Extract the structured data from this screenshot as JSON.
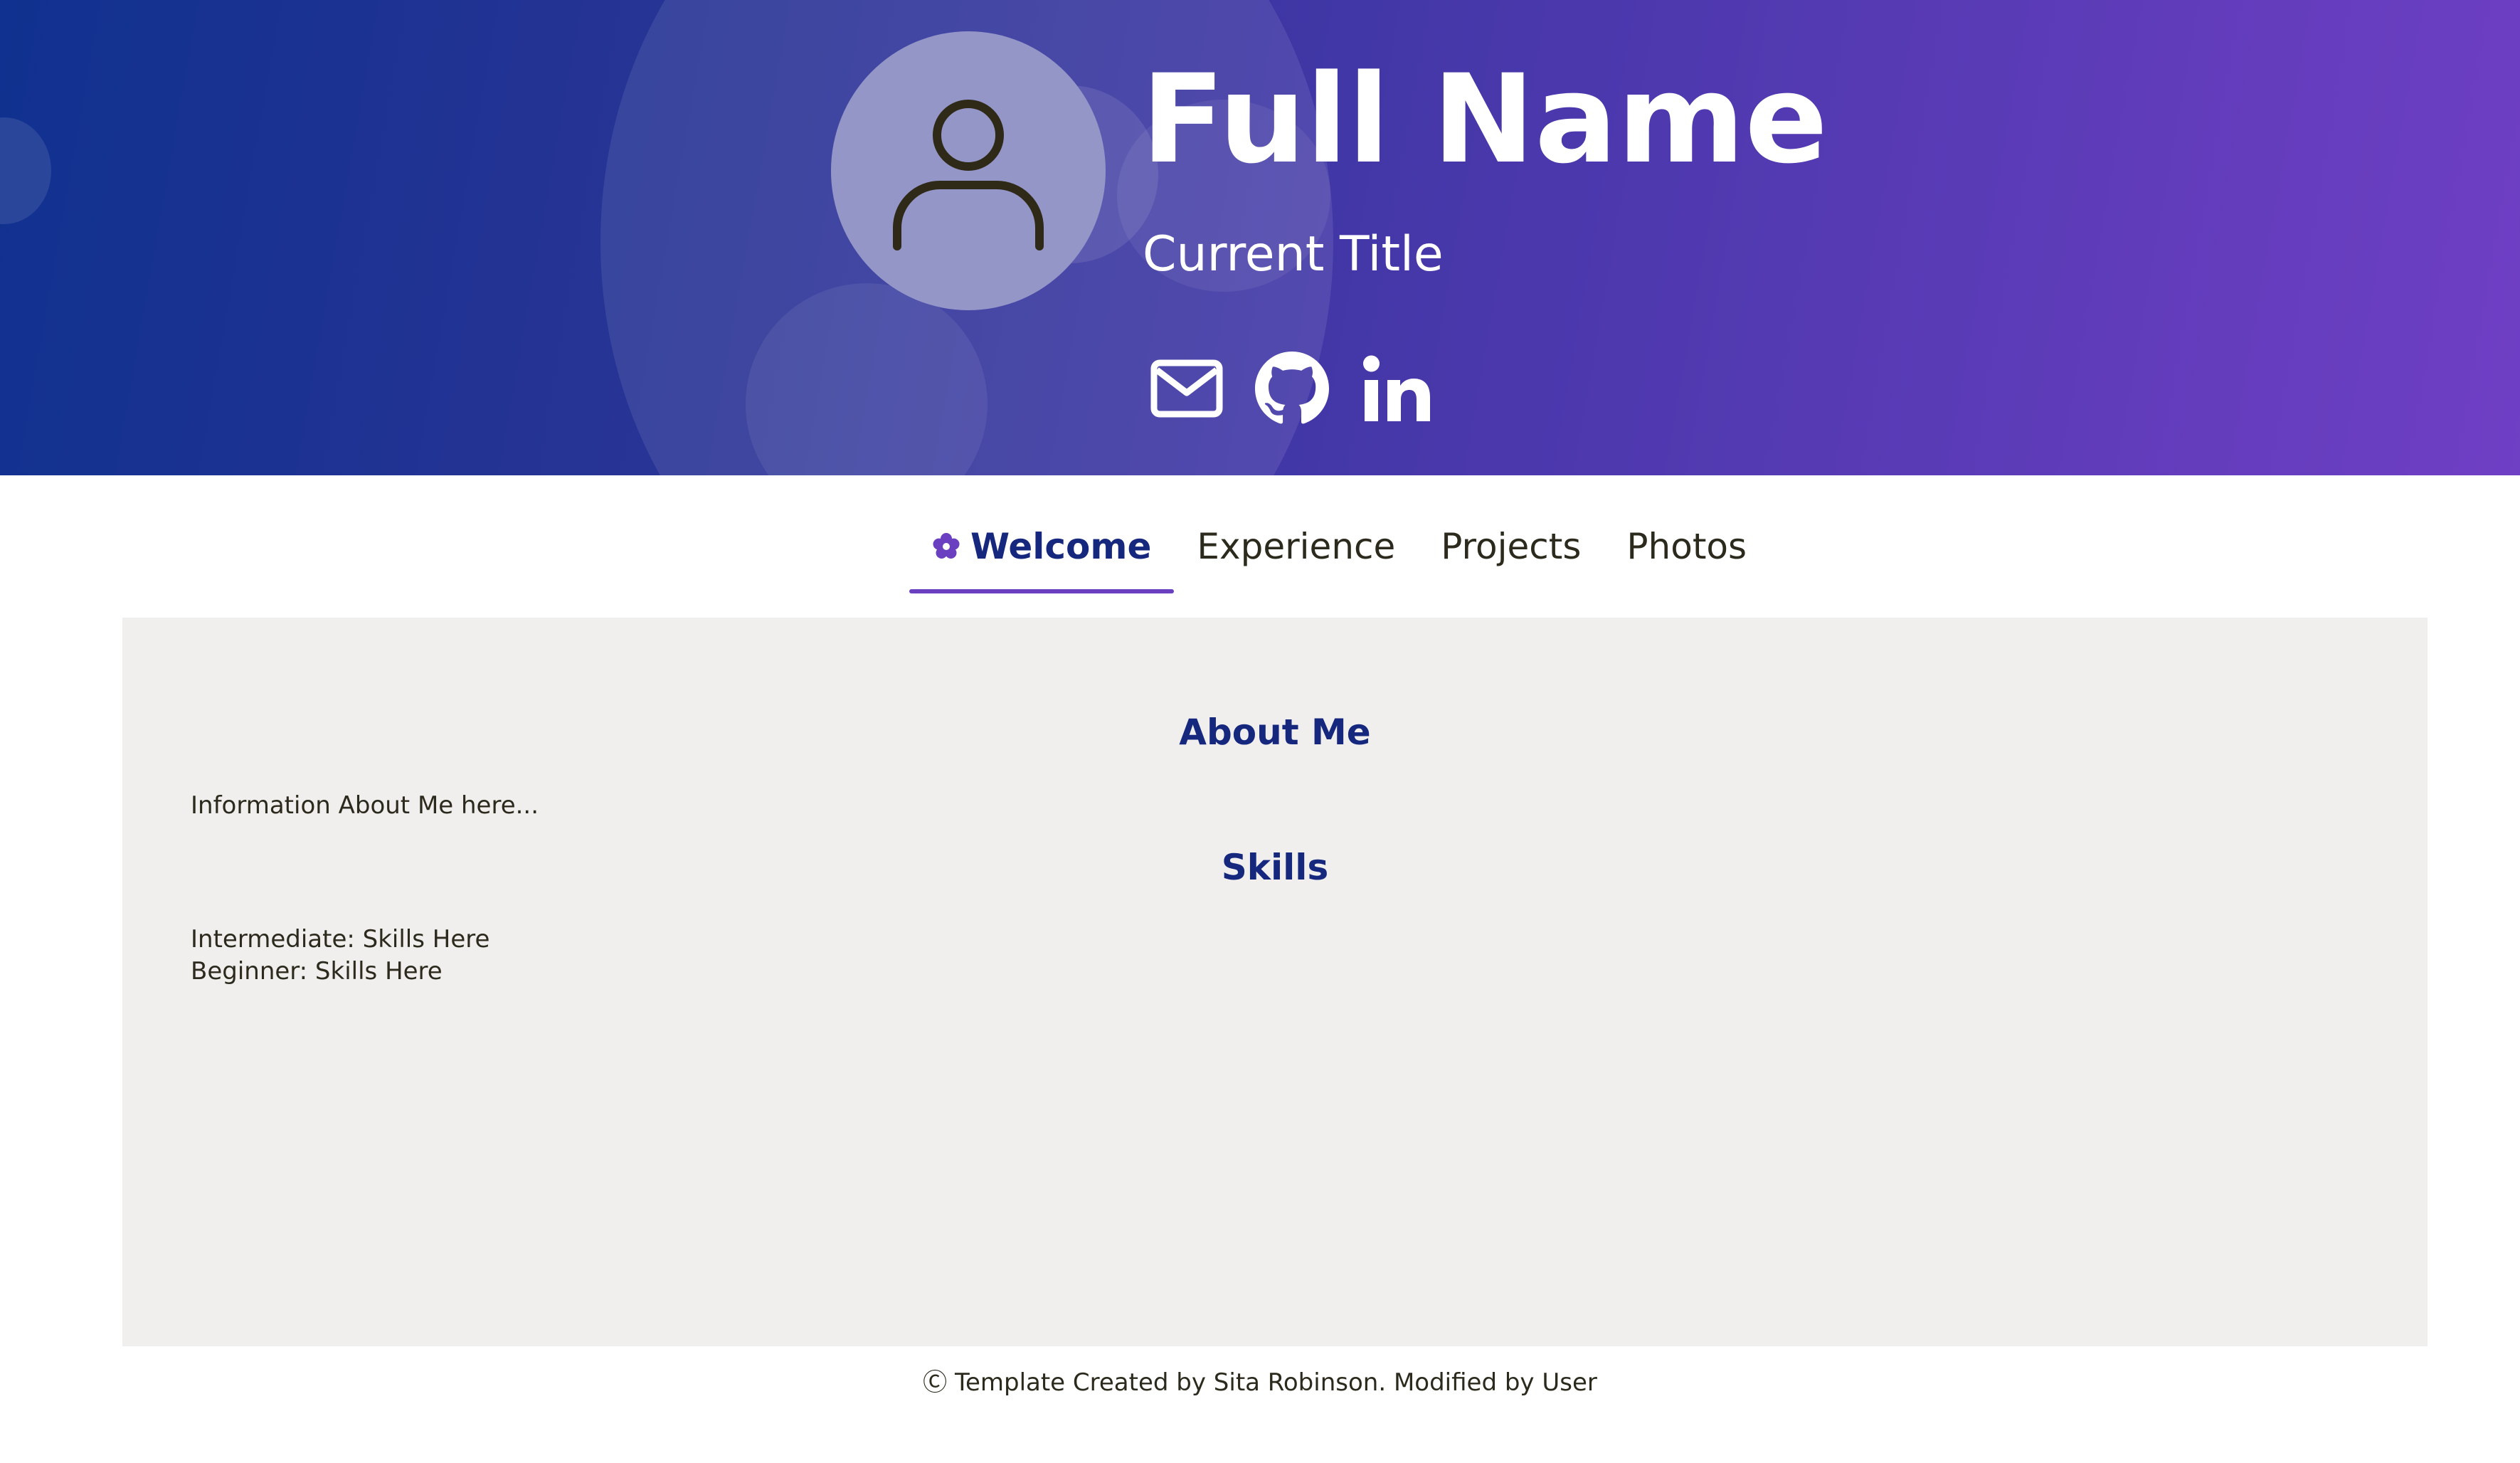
{
  "header": {
    "full_name": "Full Name",
    "current_title": "Current Title",
    "avatar_icon": "user-icon",
    "social_links": [
      {
        "icon": "envelope-icon",
        "label": "Email"
      },
      {
        "icon": "github-icon",
        "label": "GitHub"
      },
      {
        "icon": "linkedin-icon",
        "label": "LinkedIn"
      }
    ],
    "gradient_colors": [
      "#10318f",
      "#6f3fc4"
    ]
  },
  "nav": {
    "active_tab_icon": "flower-icon",
    "tabs": [
      {
        "label": "Welcome",
        "active": true
      },
      {
        "label": "Experience",
        "active": false
      },
      {
        "label": "Projects",
        "active": false
      },
      {
        "label": "Photos",
        "active": false
      }
    ],
    "accent_color": "#6a3fc0",
    "active_color": "#15287e"
  },
  "main": {
    "about_heading": "About Me",
    "about_text": "Information About Me here...",
    "skills_heading": "Skills",
    "skills": [
      "Intermediate: Skills Here",
      "Beginner: Skills Here"
    ]
  },
  "footer": {
    "text": "Ⓒ Template Created by Sita Robinson. Modified by User"
  }
}
